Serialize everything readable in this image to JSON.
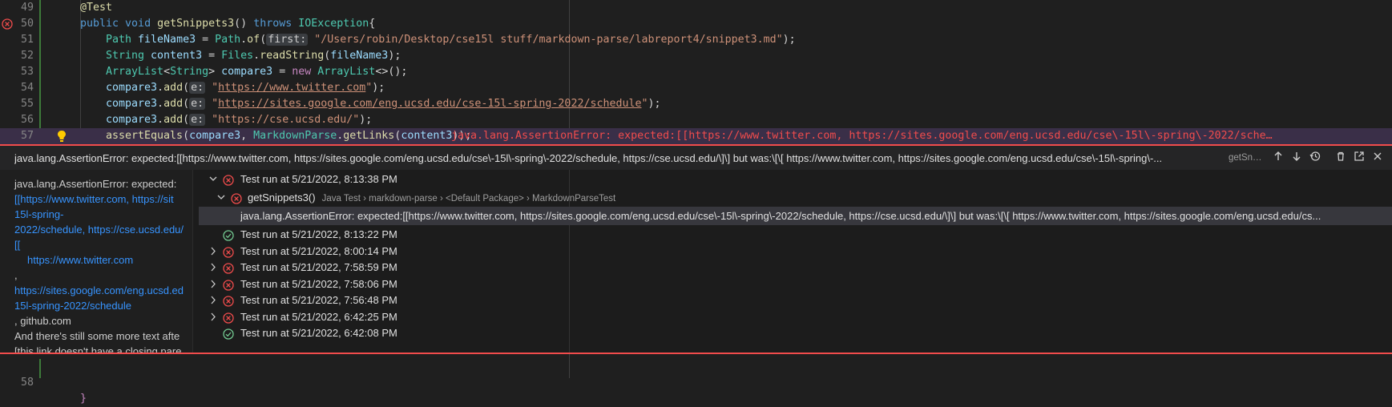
{
  "editor": {
    "lines": [
      {
        "num": "49",
        "tokens": [
          [
            "ann",
            "@Test"
          ]
        ]
      },
      {
        "num": "50",
        "tokens": [
          [
            "kw",
            "public "
          ],
          [
            "kw",
            "void "
          ],
          [
            "fn",
            "getSnippets3"
          ],
          [
            "",
            "() "
          ],
          [
            "kw",
            "throws "
          ],
          [
            "ty",
            "IOException"
          ],
          [
            "",
            "{"
          ]
        ]
      },
      {
        "num": "51",
        "tokens": [
          [
            "ty",
            "Path "
          ],
          [
            "va",
            "fileName3"
          ],
          [
            "",
            " = "
          ],
          [
            "ty",
            "Path"
          ],
          [
            "",
            "."
          ],
          [
            "fn",
            "of"
          ],
          [
            "",
            "("
          ],
          [
            "hint",
            "first:"
          ],
          [
            "st",
            " \"/Users/robin/Desktop/cse15l stuff/markdown-parse/labreport4/snippet3.md\""
          ],
          [
            "",
            ");"
          ]
        ]
      },
      {
        "num": "52",
        "tokens": [
          [
            "ty",
            "String "
          ],
          [
            "va",
            "content3"
          ],
          [
            "",
            " = "
          ],
          [
            "ty",
            "Files"
          ],
          [
            "",
            "."
          ],
          [
            "fn",
            "readString"
          ],
          [
            "",
            "("
          ],
          [
            "va",
            "fileName3"
          ],
          [
            "",
            ");"
          ]
        ]
      },
      {
        "num": "53",
        "tokens": [
          [
            "ty",
            "ArrayList"
          ],
          [
            "",
            "<"
          ],
          [
            "ty",
            "String"
          ],
          [
            "",
            "> "
          ],
          [
            "va",
            "compare3"
          ],
          [
            "",
            " = "
          ],
          [
            "kw2",
            "new "
          ],
          [
            "ty",
            "ArrayList"
          ],
          [
            "",
            "<>();"
          ]
        ]
      },
      {
        "num": "54",
        "tokens": [
          [
            "va",
            "compare3"
          ],
          [
            "",
            "."
          ],
          [
            "fn",
            "add"
          ],
          [
            "",
            "("
          ],
          [
            "hint",
            "e:"
          ],
          [
            "st",
            " \""
          ],
          [
            "url",
            "https://www.twitter.com"
          ],
          [
            "st",
            "\""
          ],
          [
            "",
            ");"
          ]
        ]
      },
      {
        "num": "55",
        "tokens": [
          [
            "va",
            "compare3"
          ],
          [
            "",
            "."
          ],
          [
            "fn",
            "add"
          ],
          [
            "",
            "("
          ],
          [
            "hint",
            "e:"
          ],
          [
            "st",
            " \""
          ],
          [
            "url",
            "https://sites.google.com/eng.ucsd.edu/cse-15l-spring-2022/schedule"
          ],
          [
            "st",
            "\""
          ],
          [
            "",
            ");"
          ]
        ]
      },
      {
        "num": "56",
        "tokens": [
          [
            "va",
            "compare3"
          ],
          [
            "",
            "."
          ],
          [
            "fn",
            "add"
          ],
          [
            "",
            "("
          ],
          [
            "hint",
            "e:"
          ],
          [
            "st",
            " \"https://cse.ucsd.edu/\""
          ],
          [
            "",
            ");"
          ]
        ]
      },
      {
        "num": "57",
        "tokens": [
          [
            "fn",
            "assertEquals"
          ],
          [
            "",
            "("
          ],
          [
            "va",
            "compare3"
          ],
          [
            "",
            ", "
          ],
          [
            "ty",
            "MarkdownParse"
          ],
          [
            "",
            "."
          ],
          [
            "fn",
            "getLinks"
          ],
          [
            "",
            "("
          ],
          [
            "va",
            "content3"
          ],
          [
            "",
            "));"
          ]
        ]
      }
    ],
    "inline_error": "java.lang.AssertionError: expected:[[https://www.twitter.com, https://sites.google.com/eng.ucsd.edu/cse\\-15l\\-spring\\-2022/sche…",
    "line58_num": "58",
    "line58_text": "}"
  },
  "peek": {
    "title": "java.lang.AssertionError: expected:[[https://www.twitter.com, https://sites.google.com/eng.ucsd.edu/cse\\-15l\\-spring\\-2022/schedule, https://cse.ucsd.edu/\\]\\] but was:\\[\\[ https://www.twitter.com, https://sites.google.com/eng.ucsd.edu/cse\\-15l\\-spring\\-...",
    "method": "getSn…"
  },
  "message": {
    "l1": "java.lang.AssertionError: expected:",
    "l2": "[[https://www.twitter.com, https://sit",
    "l3": "15l-spring-",
    "l4": "2022/schedule, https://cse.ucsd.edu/",
    "l5": "[[",
    "l6": "https://www.twitter.com",
    "l7": ",",
    "l8": "https://sites.google.com/eng.ucsd.ed",
    "l9": "15l-spring-2022/schedule",
    "l10": ", github.com",
    "l11": "And there's still some more text afte",
    "l12": "[this link doesn't have a closing pare"
  },
  "history": {
    "run1": "Test run at 5/21/2022, 8:13:38 PM",
    "method_label": "getSnippets3()",
    "method_desc": "Java Test › markdown-parse › <Default Package> › MarkdownParseTest",
    "error_row": "java.lang.AssertionError: expected:[[https://www.twitter.com, https://sites.google.com/eng.ucsd.edu/cse\\-15l\\-spring\\-2022/schedule, https://cse.ucsd.edu/\\]\\] but was:\\[\\[    https://www.twitter.com, https://sites.google.com/eng.ucsd.edu/cs...",
    "runs": [
      {
        "label": "Test run at 5/21/2022, 8:13:22 PM",
        "status": "pass",
        "expandable": false
      },
      {
        "label": "Test run at 5/21/2022, 8:00:14 PM",
        "status": "fail",
        "expandable": true
      },
      {
        "label": "Test run at 5/21/2022, 7:58:59 PM",
        "status": "fail",
        "expandable": true
      },
      {
        "label": "Test run at 5/21/2022, 7:58:06 PM",
        "status": "fail",
        "expandable": true
      },
      {
        "label": "Test run at 5/21/2022, 7:56:48 PM",
        "status": "fail",
        "expandable": true
      },
      {
        "label": "Test run at 5/21/2022, 6:42:25 PM",
        "status": "fail",
        "expandable": true
      },
      {
        "label": "Test run at 5/21/2022, 6:42:08 PM",
        "status": "pass",
        "expandable": false
      }
    ]
  },
  "colors": {
    "fail": "#f14c4c",
    "pass": "#73c991"
  },
  "icons": [
    "error-icon",
    "lightbulb-icon",
    "arrow-up-icon",
    "arrow-down-icon",
    "history-icon",
    "trash-icon",
    "open-external-icon",
    "close-icon",
    "chevron-down-icon",
    "chevron-right-icon",
    "check-icon"
  ]
}
